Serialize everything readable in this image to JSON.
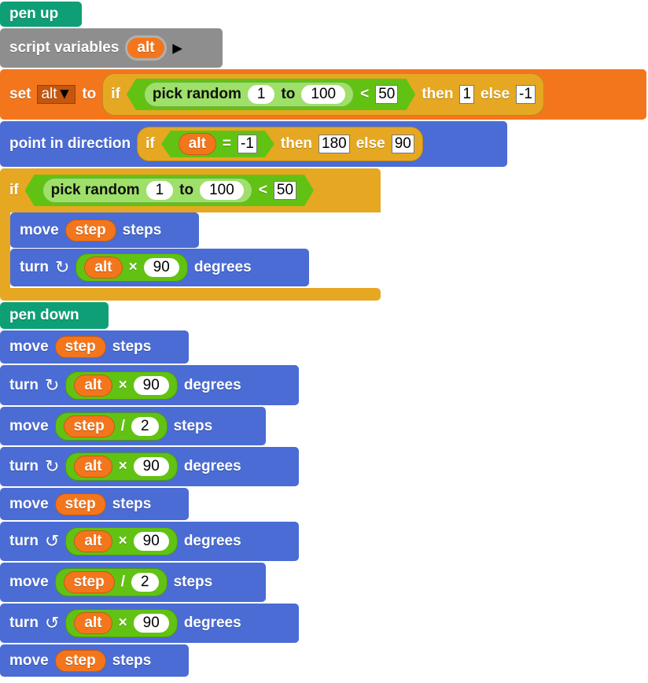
{
  "colors": {
    "pen": "#0e9f76",
    "variables": "#f3761d",
    "motion": "#4a6cd4",
    "control": "#e6a822",
    "operators": "#62c213",
    "other": "#8e8e8e"
  },
  "pen_up": "pen up",
  "script_vars": {
    "label": "script variables",
    "var": "alt",
    "arrow": "▶"
  },
  "set": {
    "label": "set",
    "var": "alt",
    "to": "to",
    "if": "if",
    "pick": "pick random",
    "from": "1",
    "to2": "to",
    "max": "100",
    "lt": "<",
    "threshold": "50",
    "then": "then",
    "then_val": "1",
    "else": "else",
    "else_val": "-1"
  },
  "point": {
    "label": "point in direction",
    "if": "if",
    "var": "alt",
    "eq": "=",
    "cmp": "-1",
    "then": "then",
    "then_val": "180",
    "else": "else",
    "else_val": "90"
  },
  "if_block": {
    "if": "if",
    "pick": "pick random",
    "from": "1",
    "to": "to",
    "max": "100",
    "lt": "<",
    "threshold": "50"
  },
  "words": {
    "move": "move",
    "steps": "steps",
    "turn": "turn",
    "degrees": "degrees",
    "step": "step",
    "alt": "alt",
    "times": "×",
    "div": "/",
    "two": "2",
    "ninety": "90",
    "cw": "↻",
    "ccw": "↺"
  },
  "pen_down": "pen down"
}
